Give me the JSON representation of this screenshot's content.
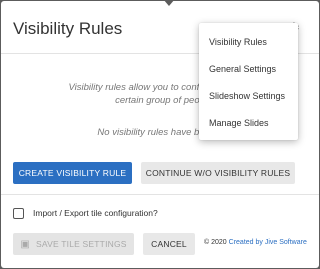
{
  "dialog": {
    "title": "Visibility Rules",
    "description_line1": "Visibility rules allow you to configure conten",
    "description_line2": "certain group of peop",
    "empty_message": "No visibility rules have been c"
  },
  "buttons": {
    "create_rule": "CREATE VISIBILITY RULE",
    "continue_without": "CONTINUE W/O VISIBILITY RULES",
    "save_tile": "SAVE TILE SETTINGS",
    "cancel": "CANCEL"
  },
  "import_export": {
    "label": "Import / Export tile configuration?",
    "checked": false
  },
  "footer": {
    "copyright": "© 2020",
    "link_text": "Created by Jive Software"
  },
  "menu": {
    "items": [
      {
        "label": "Visibility Rules"
      },
      {
        "label": "General Settings"
      },
      {
        "label": "Slideshow Settings"
      },
      {
        "label": "Manage Slides"
      }
    ]
  },
  "icons": {
    "settings": "gear-icon",
    "save": "floppy-disk-icon"
  },
  "colors": {
    "primary": "#2b6fc2",
    "secondary_bg": "#e8e8e8",
    "overlay": "#5c5c5c"
  }
}
